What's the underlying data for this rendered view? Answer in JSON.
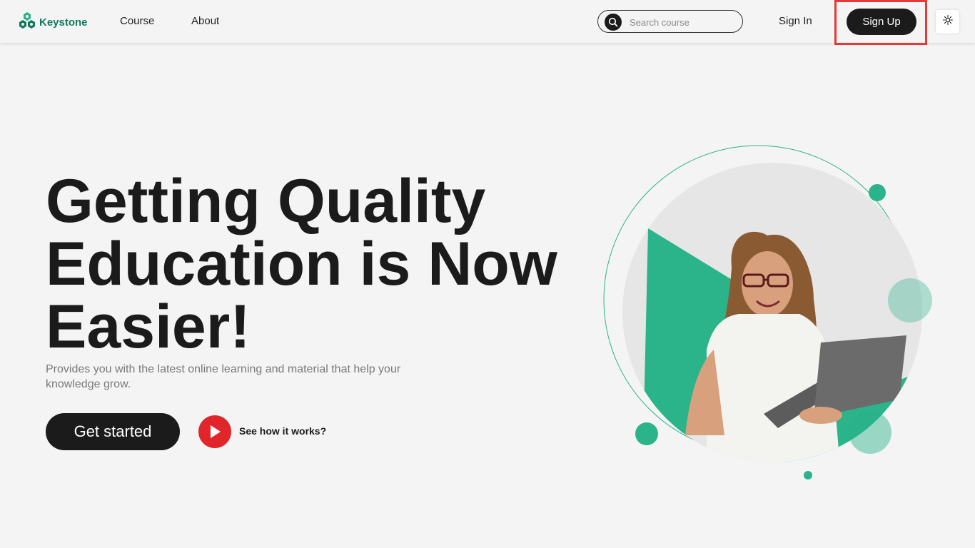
{
  "brand": {
    "name": "Keystone",
    "color": "#13795e"
  },
  "nav": {
    "links": [
      "Course",
      "About"
    ]
  },
  "search": {
    "placeholder": "Search course",
    "icon": "search-icon"
  },
  "auth": {
    "signin_label": "Sign In",
    "signup_label": "Sign Up"
  },
  "theme": {
    "icon": "sun-icon"
  },
  "hero": {
    "title_lines": [
      "Getting Quality",
      "Education is Now",
      "Easier!"
    ],
    "subtitle": "Provides you with the latest online learning and material that help your knowledge grow.",
    "cta_label": "Get started",
    "video_label": "See how it works?",
    "video_icon": "play-icon"
  },
  "colors": {
    "accent": "#2bb38a",
    "dark": "#1b1b1b",
    "play": "#e0262b",
    "highlight": "#e53935"
  }
}
